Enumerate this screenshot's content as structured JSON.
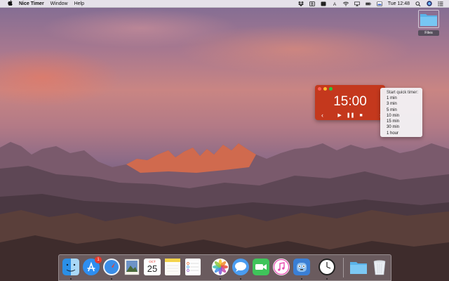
{
  "menubar": {
    "app_name": "Nice Timer",
    "menus": [
      "Window",
      "Help"
    ],
    "clock": "Tue 12:48",
    "status_icons": [
      "dropbox-icon",
      "bold-b-icon",
      "timer-status-icon",
      "a-status-icon",
      "wifi-icon",
      "airplay-icon",
      "battery-icon",
      "input-source-icon",
      "search-icon",
      "siri-icon",
      "notification-center-icon"
    ]
  },
  "desktop": {
    "folder_label": "Files"
  },
  "timer_window": {
    "time": "15:00",
    "background": "#c4381d",
    "controls": [
      "prev-arrow",
      "play",
      "pause",
      "stop",
      "next-arrow"
    ]
  },
  "quick_menu": {
    "title": "Start quick timer:",
    "items": [
      "1 min",
      "3 min",
      "5 min",
      "10 min",
      "15 min",
      "30 min",
      "1 hour"
    ]
  },
  "dock": {
    "apps": [
      "finder",
      "app-store",
      "safari",
      "preview",
      "calendar",
      "notes",
      "reminders",
      "photos",
      "messages",
      "facetime",
      "itunes",
      "tweetbot",
      "clock"
    ],
    "app_store_badge": "1",
    "calendar_month": "OCT",
    "calendar_day": "25",
    "trailing": [
      "folder",
      "trash"
    ]
  }
}
